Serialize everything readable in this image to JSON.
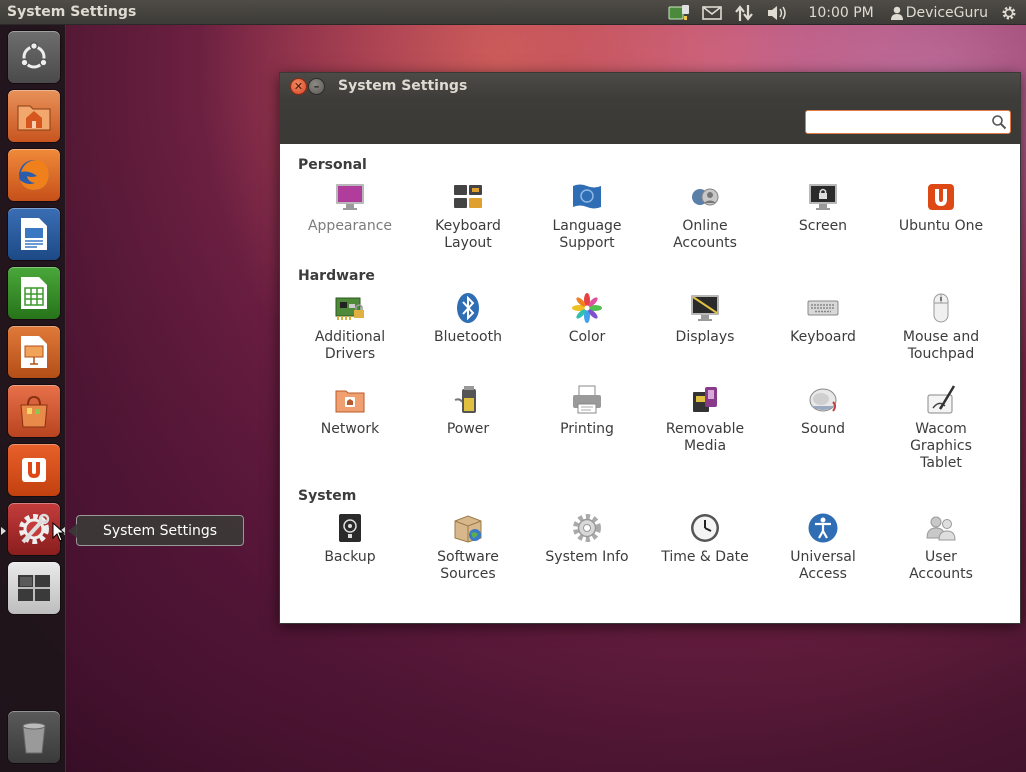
{
  "top_panel": {
    "title": "System Settings",
    "clock": "10:00 PM",
    "user": "DeviceGuru"
  },
  "launcher_tooltip": "System Settings",
  "window": {
    "title": "System Settings",
    "search_placeholder": ""
  },
  "sections": {
    "personal": "Personal",
    "hardware": "Hardware",
    "system": "System"
  },
  "items": {
    "appearance": "Appearance",
    "keyboard_layout": "Keyboard\nLayout",
    "language_support": "Language\nSupport",
    "online_accounts": "Online\nAccounts",
    "screen": "Screen",
    "ubuntu_one": "Ubuntu One",
    "additional_drivers": "Additional\nDrivers",
    "bluetooth": "Bluetooth",
    "color": "Color",
    "displays": "Displays",
    "keyboard": "Keyboard",
    "mouse_touchpad": "Mouse and\nTouchpad",
    "network": "Network",
    "power": "Power",
    "printing": "Printing",
    "removable_media": "Removable\nMedia",
    "sound": "Sound",
    "wacom": "Wacom\nGraphics\nTablet",
    "backup": "Backup",
    "software_sources": "Software\nSources",
    "system_info": "System Info",
    "time_date": "Time & Date",
    "universal_access": "Universal\nAccess",
    "user_accounts": "User\nAccounts"
  },
  "colors": {
    "accent": "#dd4814",
    "panel": "#3c3b37"
  }
}
